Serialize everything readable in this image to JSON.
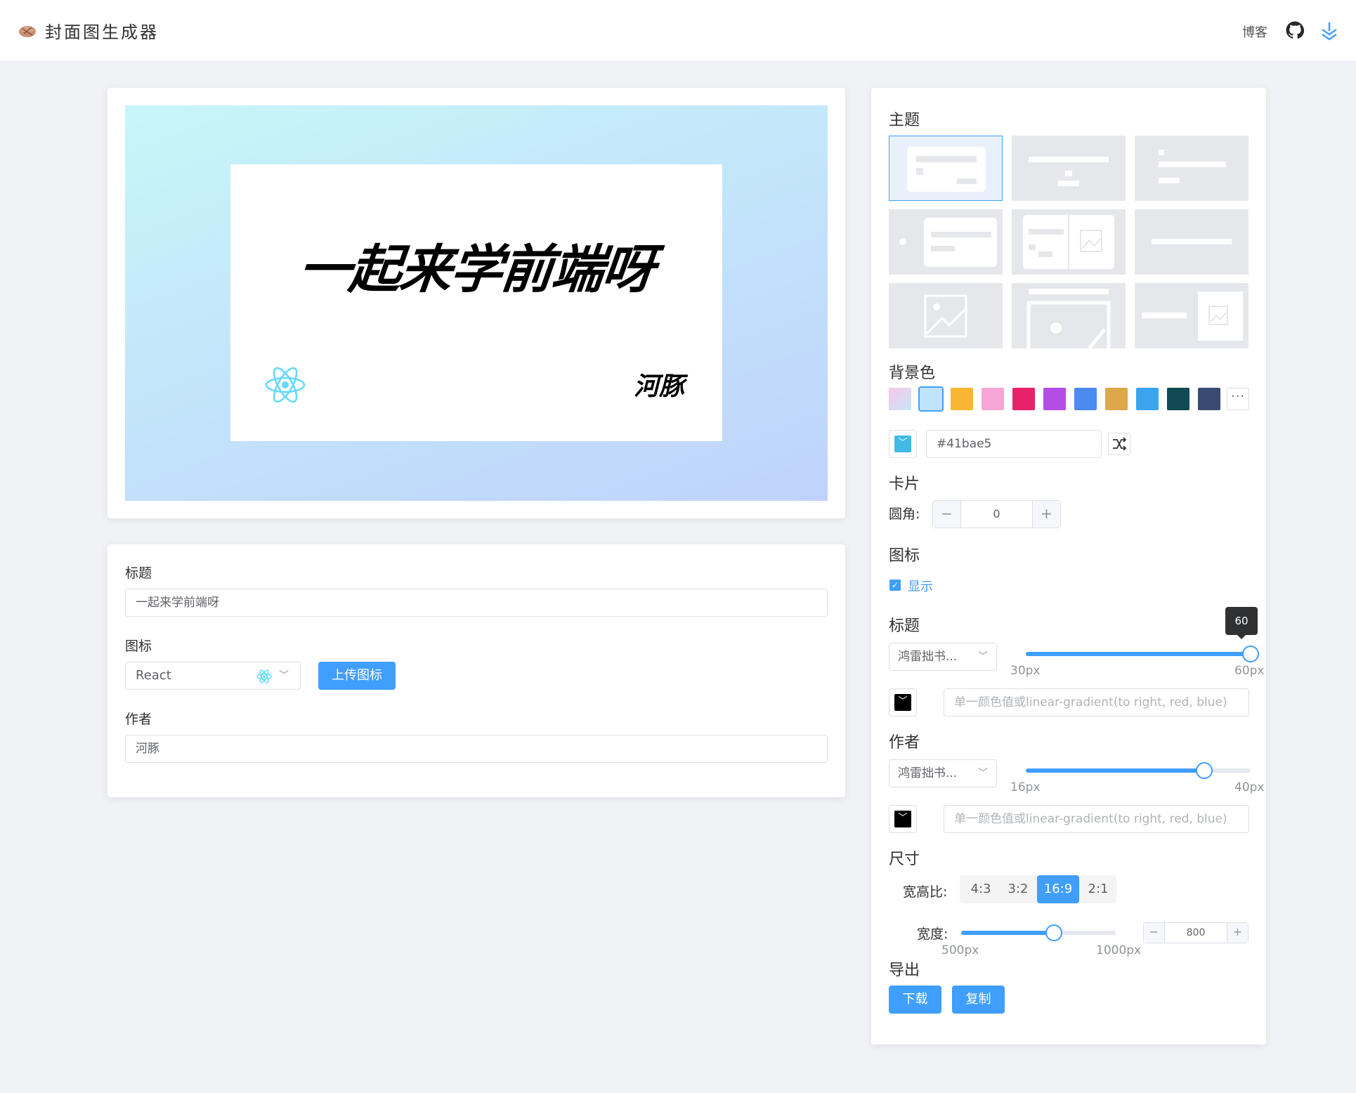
{
  "header": {
    "title": "封面图生成器",
    "blog_link": "博客"
  },
  "preview": {
    "title": "一起来学前端呀",
    "author": "河豚",
    "background_gradient": [
      "#c8f6f8",
      "#c0d2fb"
    ],
    "icon": "react-icon"
  },
  "form": {
    "title_label": "标题",
    "title_value": "一起来学前端呀",
    "icon_label": "图标",
    "icon_value": "React",
    "upload_button": "上传图标",
    "author_label": "作者",
    "author_value": "河豚"
  },
  "settings": {
    "theme_label": "主题",
    "bg_label": "背景色",
    "bg_swatches": [
      "#f8c6e8",
      "#c0e4fb",
      "#f7b733",
      "#f6a6d6",
      "#e8216b",
      "#b44de6",
      "#4b8af0",
      "#dca84a",
      "#3aa5ee",
      "#114a52",
      "#3a4a72"
    ],
    "bg_color_value": "#41bae5",
    "card_label": "卡片",
    "radius_label": "圆角:",
    "radius_value": "0",
    "icon_section_label": "图标",
    "icon_show_label": "显示",
    "title_section_label": "标题",
    "title_font": "鸿雷拙书...",
    "title_size": 60,
    "title_size_range": [
      30,
      60
    ],
    "title_size_min_label": "30px",
    "title_size_max_label": "60px",
    "title_size_tip": "60",
    "title_color_placeholder": "单一颜色值或linear-gradient(to right, red, blue)",
    "author_section_label": "作者",
    "author_font": "鸿雷拙书...",
    "author_size": 36,
    "author_size_range": [
      16,
      40
    ],
    "author_size_min_label": "16px",
    "author_size_max_label": "40px",
    "author_color_placeholder": "单一颜色值或linear-gradient(to right, red, blue)",
    "size_label": "尺寸",
    "ratio_label": "宽高比:",
    "ratios": [
      "4:3",
      "3:2",
      "16:9",
      "2:1"
    ],
    "ratio_selected": "16:9",
    "width_label": "宽度:",
    "width_value": "800",
    "width_range": [
      500,
      1000
    ],
    "width_min_label": "500px",
    "width_max_label": "1000px",
    "export_label": "导出",
    "download_button": "下载",
    "copy_button": "复制"
  }
}
